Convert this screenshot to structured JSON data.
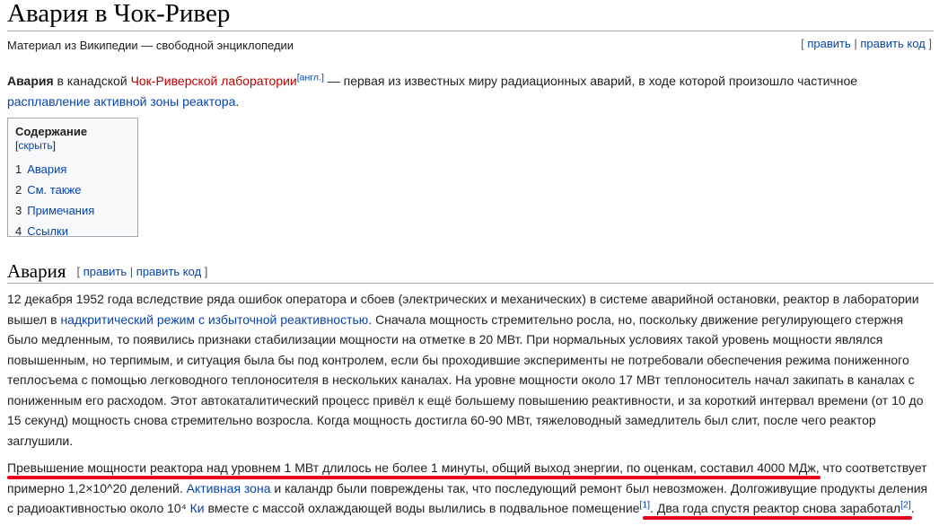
{
  "page": {
    "title": "Авария в Чок-Ривер",
    "tagline": "Материал из Википедии — свободной энциклопедии",
    "edit_links": {
      "open": "[ ",
      "edit": "править",
      "sep": " | ",
      "edit_code": "править код",
      "close": " ]"
    }
  },
  "intro": {
    "bold": "Авария",
    "t1": " в канадской ",
    "link_lab": "Чок-Риверской лаборатории",
    "sup_lang": "[англ.]",
    "t2": " — первая из известных миру радиационных аварий, в ходе которой произошло частичное ",
    "link_meltdown": "расплавление активной зоны реактора",
    "t3": "."
  },
  "toc": {
    "title": "Содержание",
    "toggle_open": " [",
    "toggle": "скрыть",
    "toggle_close": "]",
    "items": [
      {
        "num": "1",
        "label": "Авария"
      },
      {
        "num": "2",
        "label": "См. также"
      },
      {
        "num": "3",
        "label": "Примечания"
      },
      {
        "num": "4",
        "label": "Ссылки"
      }
    ]
  },
  "section": {
    "heading": "Авария",
    "edit_links": {
      "open": "[ ",
      "edit": "править",
      "sep": " | ",
      "edit_code": "править код",
      "close": " ]"
    }
  },
  "p1": {
    "t1": "12 декабря 1952 года вследствие ряда ошибок оператора и сбоев (электрических и механических) в системе аварийной остановки, реактор в лаборатории вышел в ",
    "link": "надкритический режим с избыточной реактивностью",
    "t2": ". Сначала мощность стремительно росла, но, поскольку движение регулирующего стержня было медленным, то появились признаки стабилизации мощности на отметке в 20 МВт. При нормальных условиях такой уровень мощности являлся повышенным, но терпимым, и ситуация была бы под контролем, если бы проходившие эксперименты не потребовали обеспечения режима пониженного теплосъема с помощью легководного теплоносителя в нескольких каналах. На уровне мощности около 17 МВт теплоноситель начал закипать в каналах с пониженным его расходом. Этот автокаталитический процесс привёл к ещё большему повышению реактивности, и за короткий интервал времени (от 10 до 15 секунд) мощность снова стремительно возросла. Когда мощность достигла 60-90 МВт, тяжеловодный замедлитель был слит, после чего реактор заглушили."
  },
  "p2": {
    "t1": "Превышение мощности реактора над уровнем 1 МВт длилось не более 1 минуты, общий выход энергии, по оценкам, составил 4000 МДж, что соответствует примерно 1,2×10^20 делений. ",
    "link1": "Активная зона",
    "t2": " и каландр были повреждены так, что последующий ремонт был невозможен. Долгоживущие продукты деления с радиоактивностью около 10⁴ ",
    "link2": "Ки",
    "t3": " вместе с массой охлаждающей воды вылились в подвальное помещение",
    "sup1": "[1]",
    "t4": ". ",
    "t5": "Два года спустя реактор снова заработал",
    "sup2": "[2]",
    "t6": "."
  },
  "colors": {
    "link": "#0645ad",
    "redlink": "#ba0000",
    "annotation": "#e8001c"
  }
}
